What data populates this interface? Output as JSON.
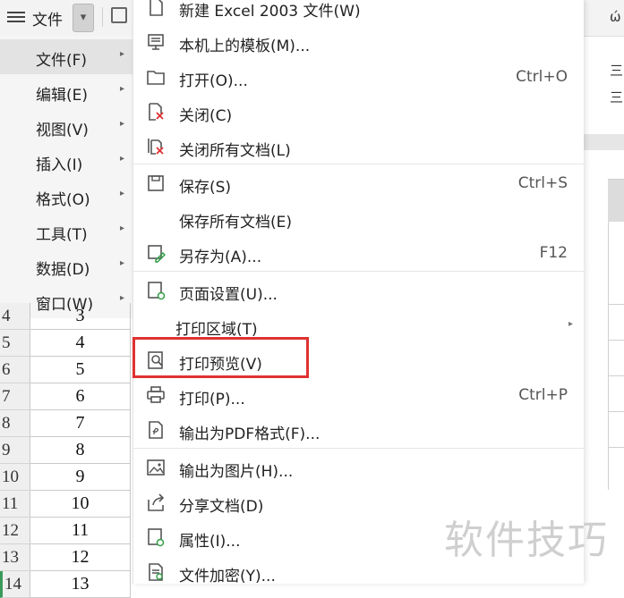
{
  "toolbar": {
    "file_label": "文件"
  },
  "left_menu": [
    {
      "label": "文件(F)"
    },
    {
      "label": "编辑(E)"
    },
    {
      "label": "视图(V)"
    },
    {
      "label": "插入(I)"
    },
    {
      "label": "格式(O)"
    },
    {
      "label": "工具(T)"
    },
    {
      "label": "数据(D)"
    },
    {
      "label": "窗口(W)"
    }
  ],
  "sheet": {
    "rows": [
      {
        "num": "4",
        "value": "3"
      },
      {
        "num": "5",
        "value": "4"
      },
      {
        "num": "6",
        "value": "5"
      },
      {
        "num": "7",
        "value": "6"
      },
      {
        "num": "8",
        "value": "7"
      },
      {
        "num": "9",
        "value": "8"
      },
      {
        "num": "10",
        "value": "9"
      },
      {
        "num": "11",
        "value": "10"
      },
      {
        "num": "12",
        "value": "11"
      },
      {
        "num": "13",
        "value": "12"
      },
      {
        "num": "14",
        "value": "13"
      }
    ]
  },
  "file_menu": [
    {
      "label": "新建 Excel 2003 文件(W)",
      "shortcut": "",
      "icon": "new-file-icon"
    },
    {
      "label": "本机上的模板(M)...",
      "shortcut": "",
      "icon": "template-icon"
    },
    {
      "label": "打开(O)...",
      "shortcut": "Ctrl+O",
      "icon": "folder-icon"
    },
    {
      "label": "关闭(C)",
      "shortcut": "",
      "icon": "close-doc-icon"
    },
    {
      "label": "关闭所有文档(L)",
      "shortcut": "",
      "icon": "close-all-icon"
    },
    {
      "label": "保存(S)",
      "shortcut": "Ctrl+S",
      "icon": "save-icon"
    },
    {
      "label": "保存所有文档(E)",
      "shortcut": "",
      "icon": ""
    },
    {
      "label": "另存为(A)...",
      "shortcut": "F12",
      "icon": "save-as-icon"
    },
    {
      "label": "页面设置(U)...",
      "shortcut": "",
      "icon": "page-setup-icon"
    },
    {
      "label": "打印区域(T)",
      "shortcut": "",
      "icon": ""
    },
    {
      "label": "打印预览(V)",
      "shortcut": "",
      "icon": "print-preview-icon"
    },
    {
      "label": "打印(P)...",
      "shortcut": "Ctrl+P",
      "icon": "printer-icon"
    },
    {
      "label": "输出为PDF格式(F)...",
      "shortcut": "",
      "icon": "pdf-icon"
    },
    {
      "label": "输出为图片(H)...",
      "shortcut": "",
      "icon": "image-icon"
    },
    {
      "label": "分享文档(D)",
      "shortcut": "",
      "icon": "share-icon"
    },
    {
      "label": "属性(I)...",
      "shortcut": "",
      "icon": "properties-icon"
    },
    {
      "label": "文件加密(Y)...",
      "shortcut": "",
      "icon": "encrypt-icon"
    }
  ],
  "watermark": "软件技巧",
  "colors": {
    "highlight": "#e03131",
    "selected_row_marker": "#3a9a5b"
  }
}
